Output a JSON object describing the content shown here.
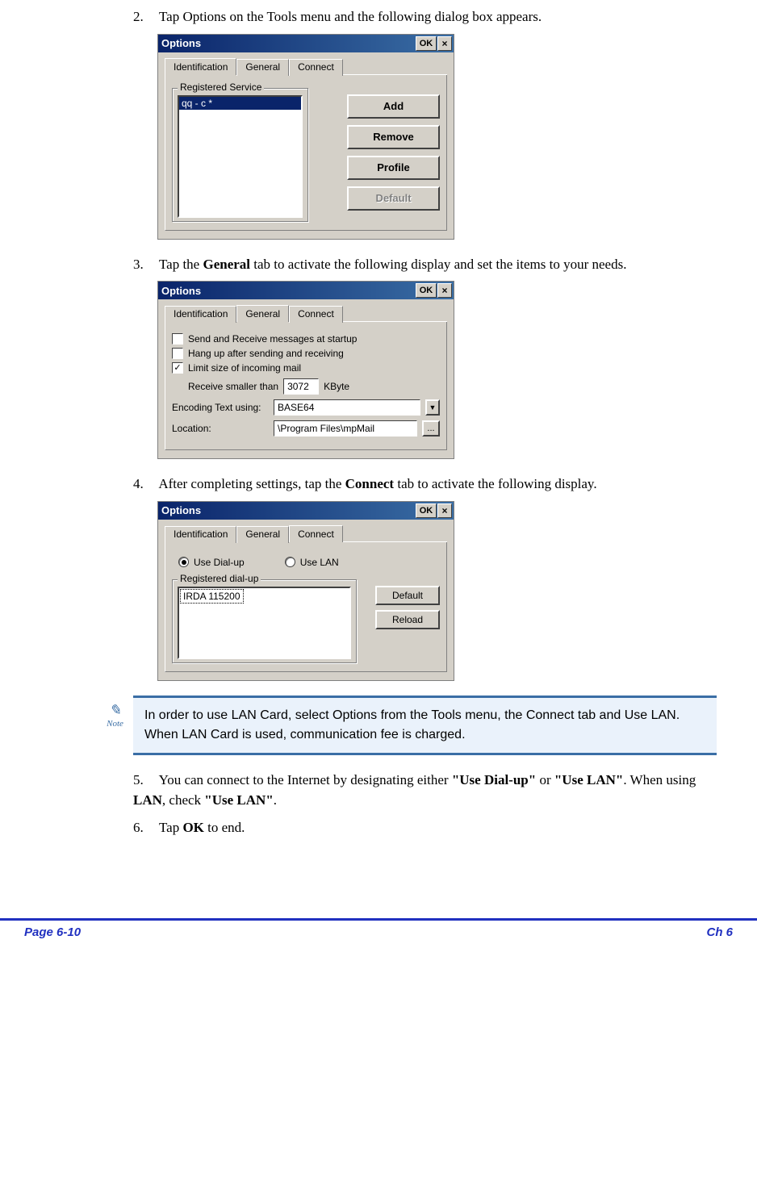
{
  "steps": {
    "s2": "Tap Options on the Tools menu and the following dialog box appears.",
    "s3_pre": "Tap the ",
    "s3_bold": "General",
    "s3_post": " tab to activate the following display and set the items to your needs.",
    "s4_pre": "After completing settings, tap the ",
    "s4_bold": "Connect",
    "s4_post": " tab to activate the following display.",
    "s5_pre": "You can connect to the Internet by designating either ",
    "s5_b1": "\"Use Dial-up\"",
    "s5_mid1": " or ",
    "s5_b2": "\"Use LAN\"",
    "s5_mid2": ". When using ",
    "s5_b3": "LAN",
    "s5_mid3": ", check ",
    "s5_b4": "\"Use LAN\"",
    "s5_end": ".",
    "s6_pre": "Tap ",
    "s6_bold": "OK",
    "s6_post": " to end."
  },
  "dialog1": {
    "title": "Options",
    "ok": "OK",
    "close": "×",
    "tabs": {
      "id": "Identification",
      "gen": "General",
      "con": "Connect"
    },
    "group": "Registered Service",
    "list_item": "qq - c *",
    "buttons": {
      "add": "Add",
      "remove": "Remove",
      "profile": "Profile",
      "def": "Default"
    }
  },
  "dialog2": {
    "title": "Options",
    "ok": "OK",
    "close": "×",
    "tabs": {
      "id": "Identification",
      "gen": "General",
      "con": "Connect"
    },
    "chk1": "Send and Receive messages at startup",
    "chk2": "Hang up after sending and receiving",
    "chk3": "Limit size of incoming mail",
    "recv_label": "Receive smaller than",
    "recv_val": "3072",
    "recv_unit": "KByte",
    "enc_label": "Encoding Text using:",
    "enc_val": "BASE64",
    "loc_label": "Location:",
    "loc_val": "\\Program Files\\mpMail",
    "browse": "..."
  },
  "dialog3": {
    "title": "Options",
    "ok": "OK",
    "close": "×",
    "tabs": {
      "id": "Identification",
      "gen": "General",
      "con": "Connect"
    },
    "r1": "Use Dial-up",
    "r2": "Use LAN",
    "group": "Registered dial-up",
    "list_item": "IRDA 115200",
    "def": "Default",
    "reload": "Reload"
  },
  "note": {
    "label": "Note",
    "text": "In order to use LAN Card, select Options from the Tools menu, the Connect tab and Use LAN. When LAN Card is used, communication fee is charged."
  },
  "footer": {
    "left": "Page 6-10",
    "right": "Ch 6"
  }
}
